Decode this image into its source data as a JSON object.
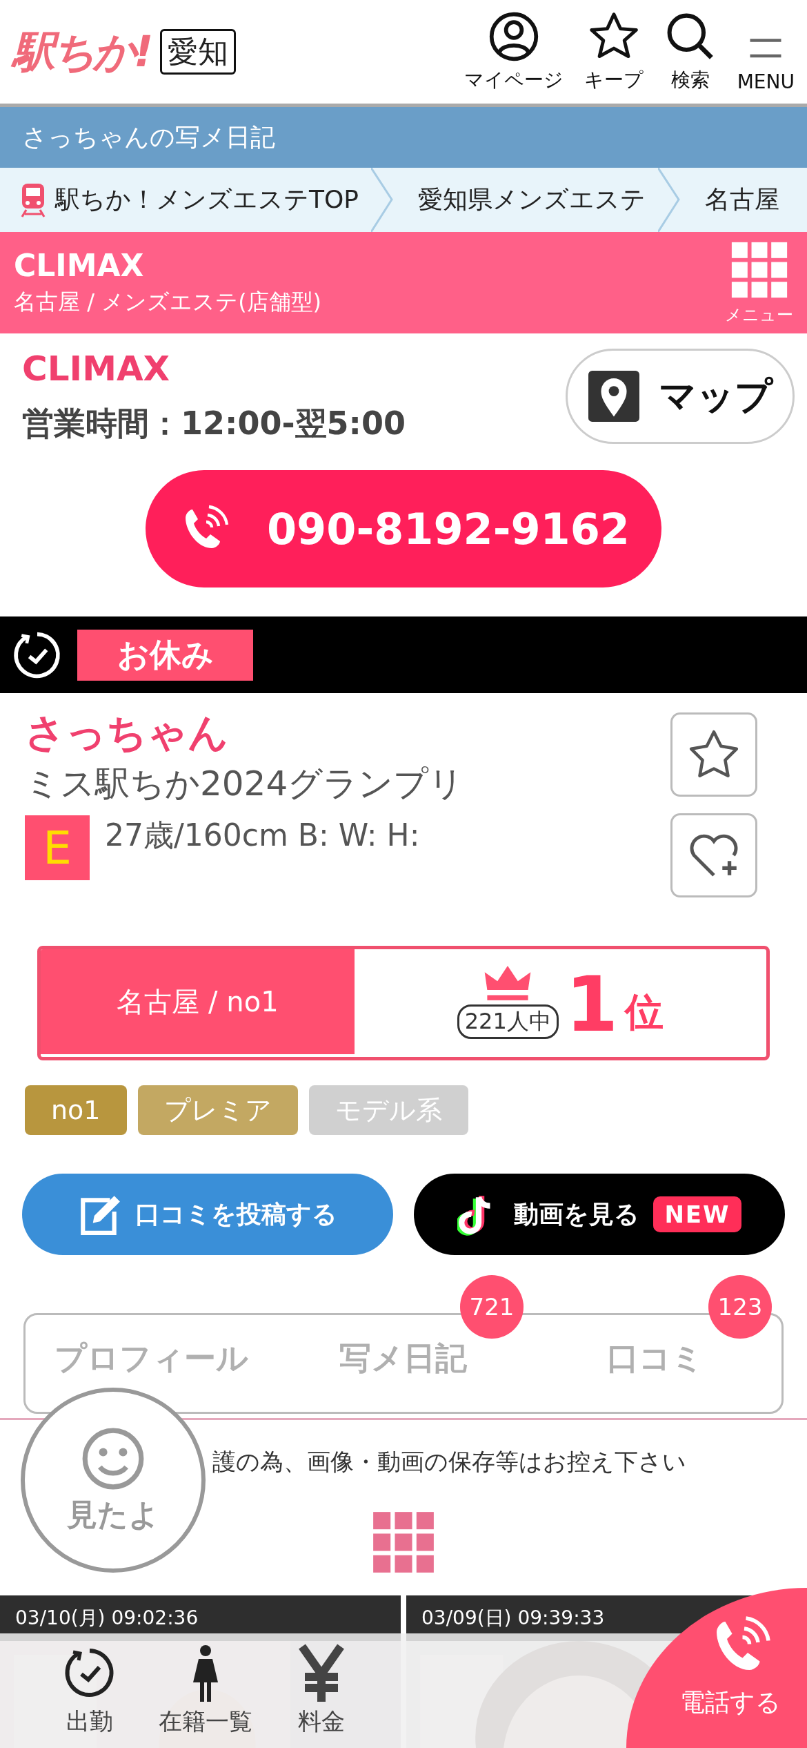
{
  "header": {
    "logo": "駅ちか!",
    "region": "愛知",
    "nav": [
      {
        "label": "マイページ"
      },
      {
        "label": "キープ"
      },
      {
        "label": "検索"
      },
      {
        "label": "MENU"
      }
    ]
  },
  "page_title": "さっちゃんの写メ日記",
  "breadcrumb": [
    "駅ちか！メンズエステTOP",
    "愛知県メンズエステ",
    "名古屋"
  ],
  "shop_bar": {
    "name": "CLIMAX",
    "category": "名古屋 / メンズエステ(店舗型)",
    "menu_label": "メニュー"
  },
  "shop": {
    "name": "CLIMAX",
    "hours": "営業時間：12:00-翌5:00",
    "map_label": "マップ",
    "phone": "090-8192-9162"
  },
  "status": {
    "label": "お休み"
  },
  "profile": {
    "name": "さっちゃん",
    "title": "ミス駅ちか2024グランプリ",
    "cup": "E",
    "specs": "27歳/160cm B: W: H:"
  },
  "ranking": {
    "area": "名古屋 / no1",
    "total": "221人中",
    "rank": "1",
    "unit": "位"
  },
  "tags": [
    {
      "label": "no1",
      "color": "#b8963e"
    },
    {
      "label": "プレミア",
      "color": "#c3a862"
    },
    {
      "label": "モデル系",
      "color": "#d0d0d0"
    }
  ],
  "actions": [
    {
      "label": "口コミを投稿する"
    },
    {
      "label": "動画を見る",
      "badge": "NEW"
    }
  ],
  "tabs": [
    {
      "label": "プロフィール",
      "selected": false
    },
    {
      "label": "写メ日記",
      "selected": false,
      "count": "721"
    },
    {
      "label": "口コミ",
      "selected": false,
      "count": "123"
    }
  ],
  "notice": "護の為、画像・動画の保存等はお控え下さい",
  "seen_button": {
    "label": "見たよ"
  },
  "diary": [
    {
      "date": "03/10(月) 09:02:36"
    },
    {
      "date": "03/09(日) 09:39:33"
    }
  ],
  "bottom_nav": [
    {
      "label": "出勤"
    },
    {
      "label": "在籍一覧"
    },
    {
      "label": "料金"
    }
  ],
  "call_button": {
    "label": "電話する"
  }
}
